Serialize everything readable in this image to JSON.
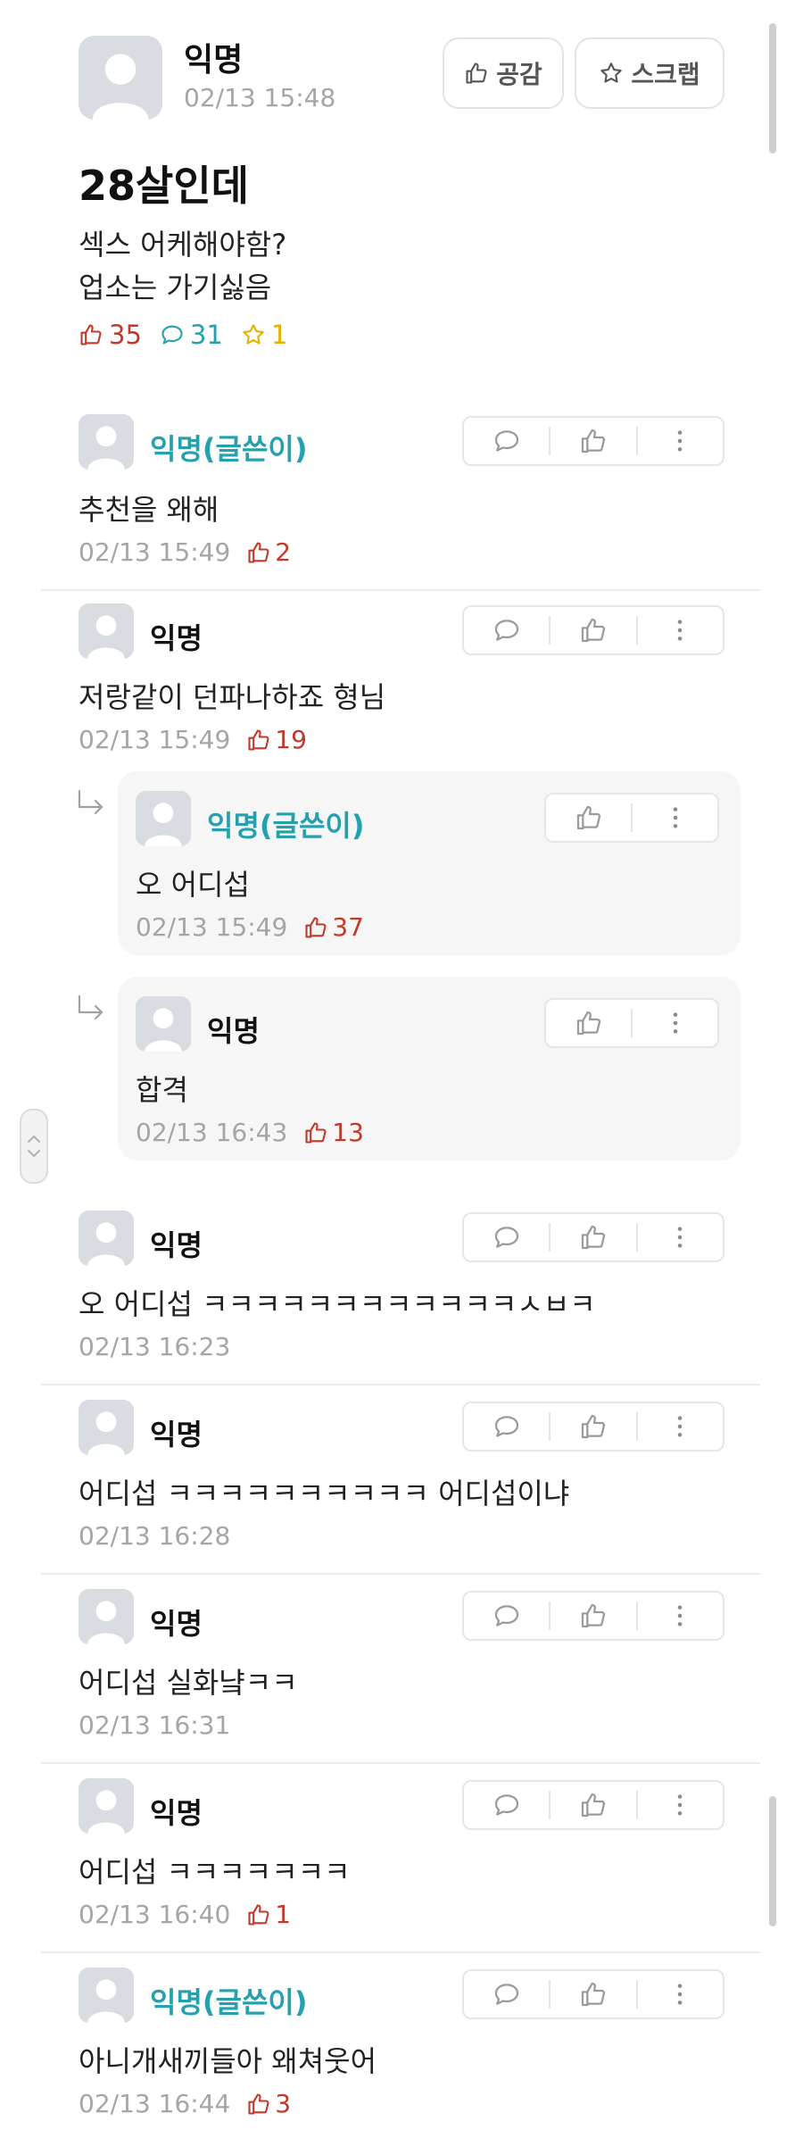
{
  "post": {
    "author": "익명",
    "time": "02/13 15:48",
    "like_button_label": "공감",
    "scrap_button_label": "스크랩",
    "title": "28살인데",
    "body_lines": [
      "섹스 어케해야함?",
      "업소는 가기싫음"
    ],
    "stats": {
      "likes": "35",
      "comments": "31",
      "scraps": "1"
    }
  },
  "comments": [
    {
      "author": "익명(글쓴이)",
      "text": "추천을 왜해",
      "time": "02/13 15:49",
      "likes": "2"
    },
    {
      "author": "익명",
      "text": "저랑같이 던파나하죠 형님",
      "time": "02/13 15:49",
      "likes": "19"
    },
    {
      "author": "익명(글쓴이)",
      "text": "오 어디섭",
      "time": "02/13 15:49",
      "likes": "37"
    },
    {
      "author": "익명",
      "text": "합격",
      "time": "02/13 16:43",
      "likes": "13"
    },
    {
      "author": "익명",
      "text": "오 어디섭 ㅋㅋㅋㅋㅋㅋㅋㅋㅋㅋㅋㅋㅅㅂㅋ",
      "time": "02/13 16:23",
      "likes": ""
    },
    {
      "author": "익명",
      "text": "어디섭 ㅋㅋㅋㅋㅋㅋㅋㅋㅋㅋ 어디섭이냐",
      "time": "02/13 16:28",
      "likes": ""
    },
    {
      "author": "익명",
      "text": "어디섭 실화냨ㅋㅋ",
      "time": "02/13 16:31",
      "likes": ""
    },
    {
      "author": "익명",
      "text": "어디섭 ㅋㅋㅋㅋㅋㅋㅋ",
      "time": "02/13 16:40",
      "likes": "1"
    },
    {
      "author": "익명(글쓴이)",
      "text": "아니개새끼들아 왜쳐웃어",
      "time": "02/13 16:44",
      "likes": "3"
    }
  ],
  "icons": {
    "like": "thumbs-up-icon",
    "comment": "speech-bubble-icon",
    "star": "star-icon",
    "more": "more-vertical-icon",
    "reply_arrow": "reply-arrow-icon",
    "avatar": "default-avatar-icon"
  },
  "colors": {
    "like": "#c0392b",
    "comment": "#27a0ad",
    "scrap": "#e0b400",
    "op_author": "#27a0ad",
    "meta": "#a5a5a5"
  }
}
